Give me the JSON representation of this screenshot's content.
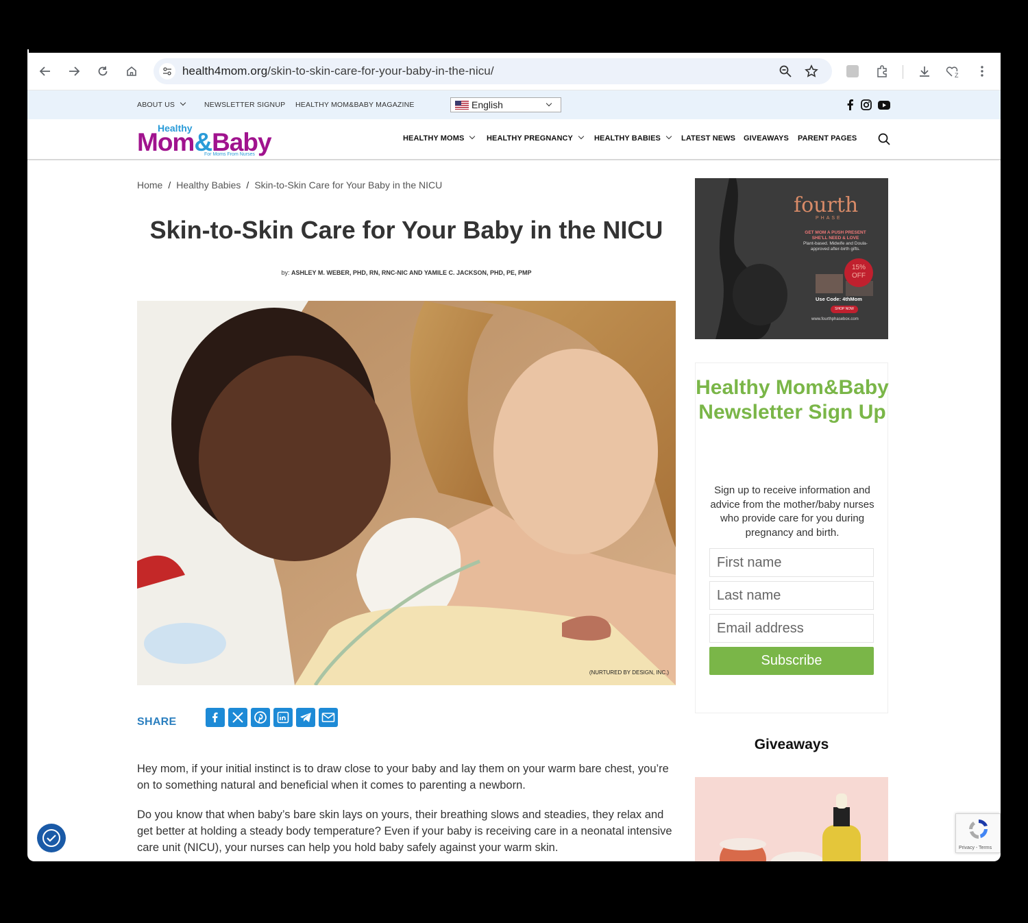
{
  "browser": {
    "url_host": "health4mom.org",
    "url_path": "/skin-to-skin-care-for-your-baby-in-the-nicu/"
  },
  "utility_nav": {
    "items": [
      "ABOUT US",
      "NEWSLETTER SIGNUP",
      "HEALTHY MOM&BABY MAGAZINE"
    ],
    "language": "English"
  },
  "logo": {
    "small": "Healthy",
    "big_a": "Mom",
    "big_amp": "&",
    "big_b": "Baby",
    "tagline": "For Moms From Nurses"
  },
  "main_nav": {
    "items": [
      "HEALTHY MOMS",
      "HEALTHY PREGNANCY",
      "HEALTHY BABIES",
      "LATEST NEWS",
      "GIVEAWAYS",
      "PARENT PAGES"
    ]
  },
  "breadcrumb": {
    "home": "Home",
    "section": "Healthy Babies",
    "current": "Skin-to-Skin Care for Your Baby in the NICU",
    "separator": "/"
  },
  "article": {
    "title": "Skin-to-Skin Care for Your Baby in the NICU",
    "by_prefix": "by:",
    "authors": "ASHLEY M. WEBER, PHD, RN, RNC-NIC AND YAMILE C. JACKSON, PHD, PE, PMP",
    "image_credit": "(NURTURED BY DESIGN, INC.)",
    "share_label": "SHARE",
    "paragraphs": [
      "Hey mom, if your initial instinct is to draw close to your baby and lay them on your warm bare chest, you’re on to something natural and beneficial when it comes to parenting a newborn.",
      "Do you know that when baby’s bare skin lays on yours, their breathing slows and steadies, they relax and get better at holding a steady body temperature? Even if your baby is receiving care in a neonatal intensive care unit (NICU), your nurses can help you hold baby safely against your warm skin."
    ]
  },
  "ad": {
    "brand": "fourth",
    "brand_sub": "PHASE",
    "line1": "GET MOM A PUSH PRESENT SHE'LL NEED & LOVE",
    "line2": "Plant-based. Midwife and Doula-approved after-birth gifts.",
    "discount": "15% OFF",
    "code": "Use Code: 4thMom",
    "shop": "SHOP NOW",
    "site": "www.fourthphasebox.com"
  },
  "newsletter": {
    "title": "Healthy Mom&Baby Newsletter Sign Up",
    "text": "Sign up to receive information and advice from the mother/baby nurses who provide care for you during pregnancy and birth.",
    "first_name": "First name",
    "last_name": "Last name",
    "email": "Email address",
    "submit": "Subscribe"
  },
  "giveaways": {
    "title": "Giveaways"
  },
  "recaptcha": {
    "links": "Privacy - Terms"
  },
  "colors": {
    "brand_magenta": "#a0138e",
    "brand_blue": "#2a9bd8",
    "newsletter_green": "#7ab648",
    "share_blue": "#1d8ad6"
  }
}
